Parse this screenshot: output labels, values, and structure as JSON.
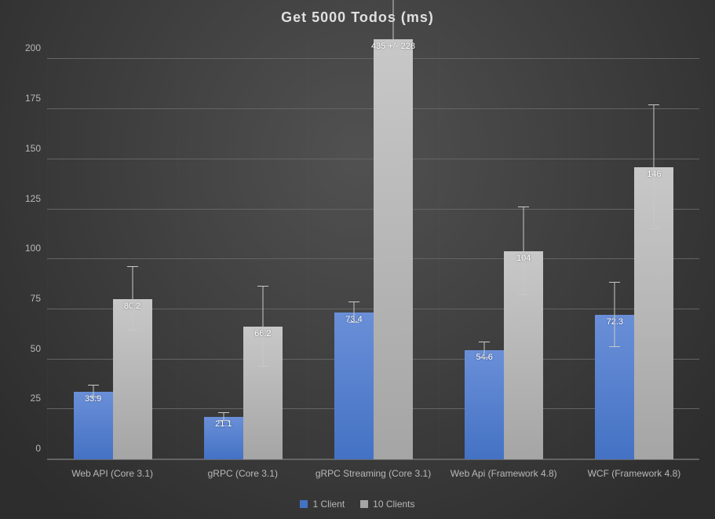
{
  "chart_data": {
    "type": "bar",
    "title": "Get 5000 Todos (ms)",
    "xlabel": "",
    "ylabel": "",
    "ylim": [
      0,
      210
    ],
    "yticks": [
      0,
      25,
      50,
      75,
      100,
      125,
      150,
      175,
      200
    ],
    "categories": [
      "Web API (Core 3.1)",
      "gRPC (Core 3.1)",
      "gRPC Streaming (Core 3.1)",
      "Web Api (Framework 4.8)",
      "WCF (Framework 4.8)"
    ],
    "legend": [
      "1 Client",
      "10 Clients"
    ],
    "legend_position": "bottom",
    "grid": true,
    "series": [
      {
        "name": "1 Client",
        "color": "#4472c4",
        "values": [
          33.9,
          21.1,
          73.4,
          54.6,
          72.3
        ],
        "labels": [
          "33.9",
          "21.1",
          "73.4",
          "54.6",
          "72.3"
        ],
        "error": [
          3,
          2,
          5,
          4,
          16
        ]
      },
      {
        "name": "10 Clients",
        "color": "#a5a5a5",
        "values": [
          80.2,
          66.2,
          435,
          104,
          146
        ],
        "labels": [
          "80.2",
          "66.2",
          "435 +/- 228",
          "104",
          "146"
        ],
        "error": [
          16,
          20,
          228,
          22,
          31
        ]
      }
    ]
  }
}
